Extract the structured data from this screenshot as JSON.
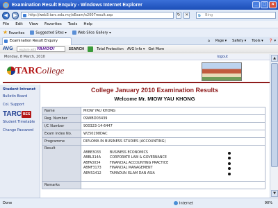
{
  "window": {
    "title": "Examination Result Enquiry - Windows Internet Explorer"
  },
  "address": {
    "url": "http://web3.tarc.edu.my/xExam/x2007result.asp",
    "search_placeholder": "Bing"
  },
  "menu": [
    "File",
    "Edit",
    "View",
    "Favorites",
    "Tools",
    "Help"
  ],
  "favorites_bar": {
    "favorites_label": "Favorites",
    "suggested": "Suggested Sites ▾",
    "webslice": "Web Slice Gallery ▾"
  },
  "tab": {
    "label": "Examination Result Enquiry"
  },
  "command_bar": {
    "page": "Page ▾",
    "safety": "Safety ▾",
    "tools": "Tools ▾",
    "help": "❓ ▾"
  },
  "avg_bar": {
    "logo": "AVG",
    "search_prefix": "explore with",
    "yahoo": "YAHOO!",
    "search_label": "SEARCH",
    "total_protection": "Total Protection",
    "avg_info": "AVG Info ▾",
    "get_more": "Get More"
  },
  "page": {
    "date": "Monday, 8 March, 2010",
    "logout": "logout",
    "logo_tar": "TARC",
    "logo_college": "ollege",
    "sidebar": {
      "title": "Student Intranet",
      "links": [
        "Bulletin Board",
        "Col. Support"
      ],
      "tarc_bes": "TARC",
      "bes": "BES",
      "timetable": "Student Timetable",
      "change_password": "Change Password"
    },
    "exam_title": "College January 2010 Examination Results",
    "welcome": "Welcome   Mr.   MIOW YAU KHONG",
    "rows": [
      {
        "label": "Name",
        "value": "MIOW YAU KHONG"
      },
      {
        "label": "Reg. Number",
        "value": "09WBD03439"
      },
      {
        "label": "I/C Number",
        "value": "900323-14-6447"
      },
      {
        "label": "Exam Index No.",
        "value": "W250298DAC"
      },
      {
        "label": "Programme",
        "value": "DIPLOMA IN BUSINESS STUDIES (ACCOUNTING)"
      }
    ],
    "result_label": "Result",
    "subjects": [
      {
        "code": "ABBE3033",
        "name": "BUSINESS ECONOMICS"
      },
      {
        "code": "ABBL314A",
        "name": "CORPORATE LAW & GOVERNANCE"
      },
      {
        "code": "ABFA3034",
        "name": "FINANCIAL ACCOUNTING PRACTICE"
      },
      {
        "code": "ABMF3173",
        "name": "FINANCIAL MANAGEMENT"
      },
      {
        "code": "AEMS1412",
        "name": "TAMADUN ISLAM DAN ASIA"
      }
    ],
    "remarks_label": "Remarks"
  },
  "status": {
    "text": "Done",
    "zone": "Internet",
    "zoom": "90%"
  }
}
